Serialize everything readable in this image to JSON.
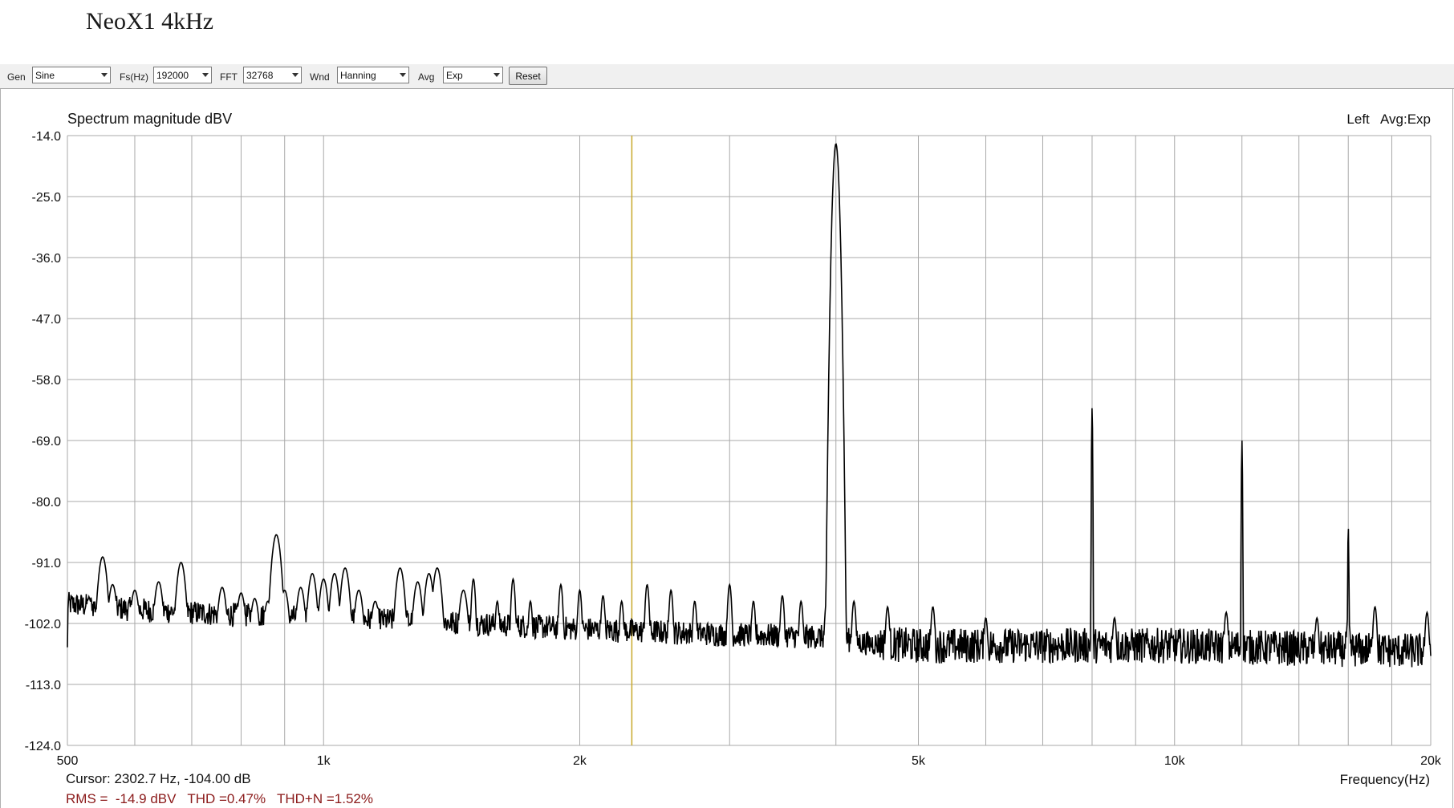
{
  "window": {
    "title": "NeoX1 4kHz"
  },
  "toolbar": {
    "gen_label": "Gen",
    "gen_value": "Sine",
    "fs_label": "Fs(Hz)",
    "fs_value": "192000",
    "fft_label": "FFT",
    "fft_value": "32768",
    "wnd_label": "Wnd",
    "wnd_value": "Hanning",
    "avg_label": "Avg",
    "avg_value": "Exp",
    "reset_label": "Reset"
  },
  "footer": {
    "cursor": "Cursor:  2302.7 Hz, -104.00 dB",
    "measurements": "RMS =  -14.9 dBV   THD =0.47%   THD+N =1.52%"
  },
  "colors": {
    "trace": "#000000",
    "grid": "#a9a9a9",
    "cursor": "#c8a82a",
    "measurements": "#8b1a1a"
  },
  "chart_data": {
    "type": "line",
    "title": "Spectrum magnitude dBV",
    "channel_label": "Left   Avg:Exp",
    "xlabel": "Frequency(Hz)",
    "x_scale": "log",
    "xlim": [
      500,
      20000
    ],
    "ylim": [
      -124,
      -14
    ],
    "x_ticks": [
      {
        "value": 500,
        "label": "500"
      },
      {
        "value": 1000,
        "label": "1k"
      },
      {
        "value": 2000,
        "label": "2k"
      },
      {
        "value": 5000,
        "label": "5k"
      },
      {
        "value": 10000,
        "label": "10k"
      },
      {
        "value": 20000,
        "label": "20k"
      }
    ],
    "x_minor_grid": [
      600,
      700,
      800,
      900,
      3000,
      4000,
      6000,
      7000,
      8000,
      9000,
      12000,
      14000,
      16000,
      18000
    ],
    "y_ticks": [
      "-14.0",
      "-25.0",
      "-36.0",
      "-47.0",
      "-58.0",
      "-69.0",
      "-80.0",
      "-91.0",
      "-102.0",
      "-113.0",
      "-124.0"
    ],
    "grid": true,
    "cursor_hz": 2302.7,
    "series": [
      {
        "noise_floor": [
          [
            500,
            -98.5
          ],
          [
            600,
            -99.5
          ],
          [
            800,
            -100.5
          ],
          [
            1000,
            -101
          ],
          [
            1500,
            -102
          ],
          [
            2000,
            -103
          ],
          [
            3000,
            -104
          ],
          [
            4000,
            -104.5
          ],
          [
            4300,
            -105.5
          ],
          [
            5000,
            -106
          ],
          [
            8000,
            -106
          ],
          [
            10000,
            -106
          ],
          [
            20000,
            -107
          ]
        ],
        "spurs": [
          [
            530,
            -97.5
          ],
          [
            550,
            -90
          ],
          [
            565,
            -95
          ],
          [
            600,
            -96
          ],
          [
            640,
            -94.5
          ],
          [
            680,
            -91
          ],
          [
            760,
            -95.5
          ],
          [
            800,
            -96.5
          ],
          [
            830,
            -97.5
          ],
          [
            860,
            -98
          ],
          [
            880,
            -86
          ],
          [
            900,
            -96
          ],
          [
            940,
            -95.5
          ],
          [
            970,
            -93
          ],
          [
            1000,
            -94
          ],
          [
            1030,
            -93
          ],
          [
            1060,
            -92
          ],
          [
            1100,
            -96
          ],
          [
            1150,
            -98
          ],
          [
            1230,
            -92
          ],
          [
            1290,
            -94.5
          ],
          [
            1330,
            -93
          ],
          [
            1360,
            -92
          ],
          [
            1460,
            -96
          ],
          [
            1500,
            -94
          ],
          [
            1600,
            -98
          ],
          [
            1670,
            -94
          ],
          [
            1750,
            -98
          ],
          [
            1900,
            -95
          ],
          [
            2000,
            -96
          ],
          [
            2130,
            -97
          ],
          [
            2240,
            -98
          ],
          [
            2400,
            -95
          ],
          [
            2560,
            -96
          ],
          [
            2730,
            -98
          ],
          [
            3000,
            -95
          ],
          [
            3200,
            -98
          ],
          [
            3460,
            -97
          ],
          [
            3640,
            -98
          ],
          [
            3900,
            -98
          ],
          [
            4200,
            -98
          ],
          [
            4600,
            -99
          ],
          [
            5200,
            -99
          ],
          [
            6000,
            -101
          ],
          [
            8500,
            -101
          ],
          [
            11500,
            -100
          ],
          [
            14700,
            -101
          ],
          [
            16000,
            -101
          ],
          [
            17200,
            -99
          ],
          [
            19800,
            -100
          ]
        ],
        "peaks": [
          [
            4000,
            -15.5
          ],
          [
            8000,
            -63
          ],
          [
            12000,
            -69
          ],
          [
            16000,
            -84.5
          ]
        ]
      }
    ]
  }
}
